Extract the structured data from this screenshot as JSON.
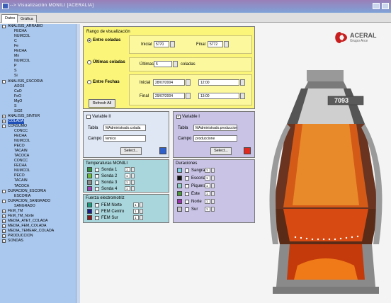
{
  "window": {
    "title": "--> Visualización MONILI [ACERALIA]"
  },
  "tabs": [
    {
      "label": "Datos"
    },
    {
      "label": "Gráfica"
    }
  ],
  "tree": {
    "items": [
      {
        "label": "ANALISIS_ARRABIO",
        "level": 0,
        "exp": "-"
      },
      {
        "label": "FECHA",
        "level": 2
      },
      {
        "label": "NUMCOL",
        "level": 2
      },
      {
        "label": "C",
        "level": 2
      },
      {
        "label": "Fe",
        "level": 2
      },
      {
        "label": "FECHA",
        "level": 2
      },
      {
        "label": "Mn",
        "level": 2
      },
      {
        "label": "NUMCOL",
        "level": 2
      },
      {
        "label": "P",
        "level": 2
      },
      {
        "label": "S",
        "level": 2
      },
      {
        "label": "Si",
        "level": 2
      },
      {
        "label": "ANALISIS_ESCORIA",
        "level": 0,
        "exp": "-"
      },
      {
        "label": "Al2O3",
        "level": 2
      },
      {
        "label": "CaO",
        "level": 2
      },
      {
        "label": "FeO",
        "level": 2
      },
      {
        "label": "MgO",
        "level": 2
      },
      {
        "label": "S",
        "level": 2
      },
      {
        "label": "SiO2",
        "level": 2
      },
      {
        "label": "ANALISIS_SINTER",
        "level": 0,
        "exp": "+"
      },
      {
        "label": "COLADA",
        "level": 0,
        "exp": "+",
        "selected": true
      },
      {
        "label": "CONSUMO",
        "level": 0,
        "exp": "-"
      },
      {
        "label": "CONCC",
        "level": 2
      },
      {
        "label": "FECHA",
        "level": 2
      },
      {
        "label": "NUMCOL",
        "level": 2
      },
      {
        "label": "PECO",
        "level": 2
      },
      {
        "label": "TACAIN",
        "level": 2
      },
      {
        "label": "TACOCA",
        "level": 2
      },
      {
        "label": "CONCC",
        "level": 2
      },
      {
        "label": "FECHA",
        "level": 2
      },
      {
        "label": "NUMCOL",
        "level": 2
      },
      {
        "label": "PECO",
        "level": 2
      },
      {
        "label": "TACAIN",
        "level": 2
      },
      {
        "label": "TACOCA",
        "level": 2
      },
      {
        "label": "DURACION_ESCORIA",
        "level": 0,
        "exp": "-"
      },
      {
        "label": "ESCORIA",
        "level": 2
      },
      {
        "label": "DURACION_SANGRADO",
        "level": 0,
        "exp": "-"
      },
      {
        "label": "SANGRADO",
        "level": 2
      },
      {
        "label": "FEM_TM",
        "level": 0,
        "exp": "+"
      },
      {
        "label": "FEM_TM_Norte",
        "level": 0,
        "exp": "+"
      },
      {
        "label": "MEDIA_ATET_COLADA",
        "level": 0,
        "exp": "+"
      },
      {
        "label": "MEDIA_FEM_COLADA",
        "level": 0,
        "exp": "+"
      },
      {
        "label": "MEDIA_TEMEAR_COLADA",
        "level": 0,
        "exp": "+"
      },
      {
        "label": "PRODUCCION",
        "level": 0,
        "exp": "+"
      },
      {
        "label": "SONDAS",
        "level": 0,
        "exp": "+"
      }
    ]
  },
  "rango": {
    "title": "Rango de visualización",
    "entre_coladas": {
      "label": "Entre coladas",
      "selected": true,
      "inicial_label": "Inicial",
      "inicial_value": "5770",
      "final_label": "Final",
      "final_value": "5772"
    },
    "ultimas": {
      "label": "Últimas coladas",
      "ultimas_label": "Últimas",
      "value": "5",
      "suffix": "coladas"
    },
    "entre_fechas": {
      "label": "Entre Fechas",
      "inicial_label": "Inicial",
      "inicial_date": "28/07/2004",
      "inicial_time": "12:00",
      "final_label": "Final",
      "final_date": "29/07/2004",
      "final_time": "13:00"
    },
    "refresh_label": "Refresh All"
  },
  "variable2": {
    "label": "Variable II",
    "checked": false,
    "tabla_label": "Tabla",
    "tabla_value": "MAdministrado.colada",
    "campo_label": "Campo",
    "campo_value": "temico",
    "select_label": "Select...",
    "color": "#2f5fc9"
  },
  "variable1": {
    "label": "Variable I",
    "checked": true,
    "tabla_label": "Tabla",
    "tabla_value": "MAdministrado.produccion",
    "campo_label": "Campo",
    "campo_value": "produccione",
    "select_label": "Select...",
    "color": "#e02a20"
  },
  "temperaturas": {
    "title": "Temperaturas MONILI",
    "items": [
      {
        "label": "Sonda 1",
        "value": "1",
        "color": "#2f8f3a"
      },
      {
        "label": "Sonda 2",
        "value": "1",
        "color": "#6fbe3a"
      },
      {
        "label": "Sonda 3",
        "value": "1",
        "color": "#8c8c8c"
      },
      {
        "label": "Sonda 4",
        "value": "1",
        "color": "#a040b8"
      }
    ]
  },
  "fuerza": {
    "title": "Fuerza electromotriz",
    "items": [
      {
        "label": "FEM Norte",
        "value": "1",
        "color": "#1a9a7a"
      },
      {
        "label": "FEM Centro",
        "value": "1",
        "color": "#1a1a8a"
      },
      {
        "label": "FEM Sur",
        "value": "1",
        "color": "#8a1a1a"
      }
    ]
  },
  "duraciones": {
    "title": "Duraciones",
    "items": [
      {
        "label": "Sangrado",
        "value": "1",
        "color": "#7ed0e6"
      },
      {
        "label": "Escoria",
        "value": "1",
        "color": "#111111"
      },
      {
        "label": "Piquera",
        "value": "1",
        "color": "#8fd0c4"
      },
      {
        "label": "Este",
        "value": "1",
        "color": "#4a9a3a"
      },
      {
        "label": "Norte",
        "value": "1",
        "color": "#a030b0"
      },
      {
        "label": "Sur",
        "value": "1",
        "color": "#c8c8c8"
      }
    ]
  },
  "furnace": {
    "display_value": "7093"
  },
  "brand": {
    "name": "ACERAL",
    "sub": "Grupo Arce"
  },
  "colors": {
    "accent": "#1e50b8",
    "tree_bg": "#aac8ee",
    "rango_bg": "#fbf67a"
  }
}
